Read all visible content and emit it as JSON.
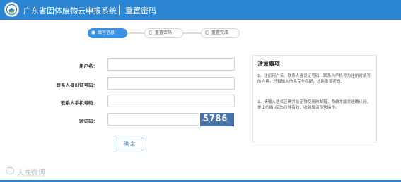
{
  "header": {
    "title": "广东省固体废物云申报系统",
    "subtitle": "重置密码",
    "bg_color": "#2c85d2",
    "logo_icon": "emblem-icon"
  },
  "steps": [
    {
      "label": "填写信息",
      "state": "active"
    },
    {
      "label": "重置密码",
      "state": "inactive"
    },
    {
      "label": "重置完成",
      "state": "inactive"
    }
  ],
  "form": {
    "username_label": "用户名：",
    "id_number_label": "联系人身份证号码：",
    "phone_label": "联系人手机号码：",
    "captcha_label": "验证码：",
    "captcha_text": "5786",
    "submit_label": "确 定"
  },
  "notice": {
    "title": "注意事项",
    "p1": "1．注册用户名、联系人身份证号码、联系人手机号为注册时填写的内容，只有输入信息完全匹配，才能重置密码；",
    "p2": "2．请输入格式正确并能正常使用的邮箱，系统才能发送确认码，发出的确认码5分钟有效，收到后请尽快操作。"
  },
  "watermark": "大成微博"
}
